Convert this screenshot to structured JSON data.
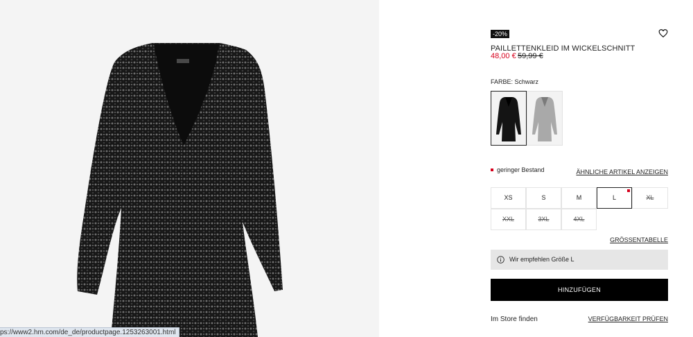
{
  "product": {
    "badge": "-20%",
    "title": "PAILLETTENKLEID IM WICKELSCHNITT",
    "price": "48,00 €",
    "old_price": "59,99 €",
    "color_label": "FARBE: Schwarz",
    "swatches": [
      {
        "name": "Schwarz",
        "color": "#151515",
        "selected": true
      },
      {
        "name": "Silber",
        "color": "#a9a9a9",
        "selected": false
      }
    ],
    "stock_text": "geringer Bestand",
    "similar_link": "ÄHNLICHE ARTIKEL ANZEIGEN",
    "sizes": [
      {
        "label": "XS",
        "available": true,
        "selected": false
      },
      {
        "label": "S",
        "available": true,
        "selected": false
      },
      {
        "label": "M",
        "available": true,
        "selected": false
      },
      {
        "label": "L",
        "available": true,
        "selected": true,
        "low_stock": true
      },
      {
        "label": "XL",
        "available": false,
        "selected": false
      },
      {
        "label": "XXL",
        "available": false,
        "selected": false
      },
      {
        "label": "3XL",
        "available": false,
        "selected": false
      },
      {
        "label": "4XL",
        "available": false,
        "selected": false
      }
    ],
    "size_guide": "GRÖSSENTABELLE",
    "recommendation": "Wir empfehlen Größe L",
    "add_button": "HINZUFÜGEN",
    "store_label": "Im Store finden",
    "availability_link": "VERFÜGBARKEIT PRÜFEN"
  },
  "status_bar": {
    "url": "ps://www2.hm.com/de_de/productpage.1253263001.html"
  },
  "icons": {
    "wishlist": "heart-icon",
    "info": "info-icon"
  },
  "colors": {
    "sale_red": "#d6001c",
    "button_black": "#000000",
    "recommend_bg": "#e6e6e6"
  }
}
